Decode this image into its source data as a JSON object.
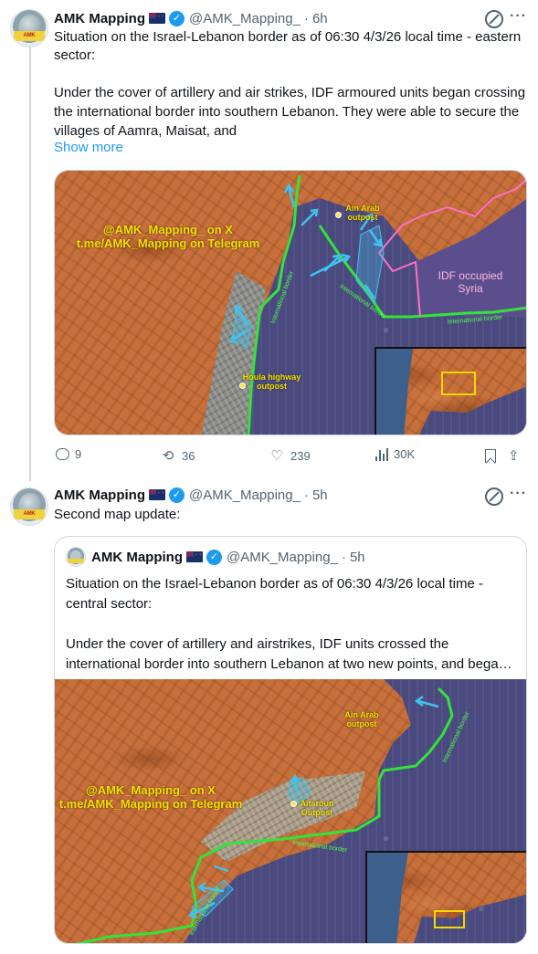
{
  "colors": {
    "link": "#1d9bf0",
    "secondary_text": "#536471",
    "verified": "#1d9bf0",
    "map_watermark": "#f5e000",
    "border_line": "#34e33a",
    "syria_border": "#ff6ec7",
    "arrow": "#3fc3f0",
    "occupied_shade": "#4b4a80",
    "lebanon_terrain": "#c7703c"
  },
  "tweet1": {
    "author_name": "AMK Mapping",
    "flag_icon": "new-zealand-flag-icon",
    "handle": "@AMK_Mapping_",
    "separator": "·",
    "time": "6h",
    "text_line1": "Situation on the Israel-Lebanon border as of 06:30 4/3/26 local time - eastern sector:",
    "text_line2": "Under the cover of artillery and air strikes, IDF armoured units began crossing the international border into southern Lebanon. They were able to secure the villages of Aamra, Maisat, and",
    "show_more": "Show more",
    "map": {
      "watermark_line1": "@AMK_Mapping_ on X",
      "watermark_line2": "t.me/AMK_Mapping on Telegram",
      "outpost_ain_arab": "Ain Arab\noutpost",
      "outpost_houla": "Houla highway\noutpost",
      "occupied_syria_line1": "IDF occupied",
      "occupied_syria_line2": "Syria",
      "border_label_1": "International border",
      "border_label_2": "International border",
      "border_label_3": "International border"
    },
    "stats": {
      "replies": "9",
      "reposts": "36",
      "likes": "239",
      "views": "30K"
    }
  },
  "tweet2": {
    "author_name": "AMK Mapping",
    "flag_icon": "new-zealand-flag-icon",
    "handle": "@AMK_Mapping_",
    "separator": "·",
    "time": "5h",
    "text": "Second map update:",
    "quote": {
      "author_name": "AMK Mapping",
      "handle": "@AMK_Mapping_",
      "separator": "·",
      "time": "5h",
      "text_line1": "Situation on the Israel-Lebanon border as of 06:30 4/3/26 local time - central sector:",
      "text_line2": "Under the cover of artillery and airstrikes, IDF units crossed the international border into southern Lebanon at two new points, and bega…",
      "map": {
        "watermark_line1": "@AMK_Mapping_ on X",
        "watermark_line2": "t.me/AMK_Mapping on Telegram",
        "outpost_ain_arab": "Ain Arab\noutpost",
        "outpost_aitaroun": "Aitaroun\nOutpost",
        "border_label_1": "International border",
        "border_label_2": "International border",
        "border_label_3": "International border"
      }
    }
  }
}
